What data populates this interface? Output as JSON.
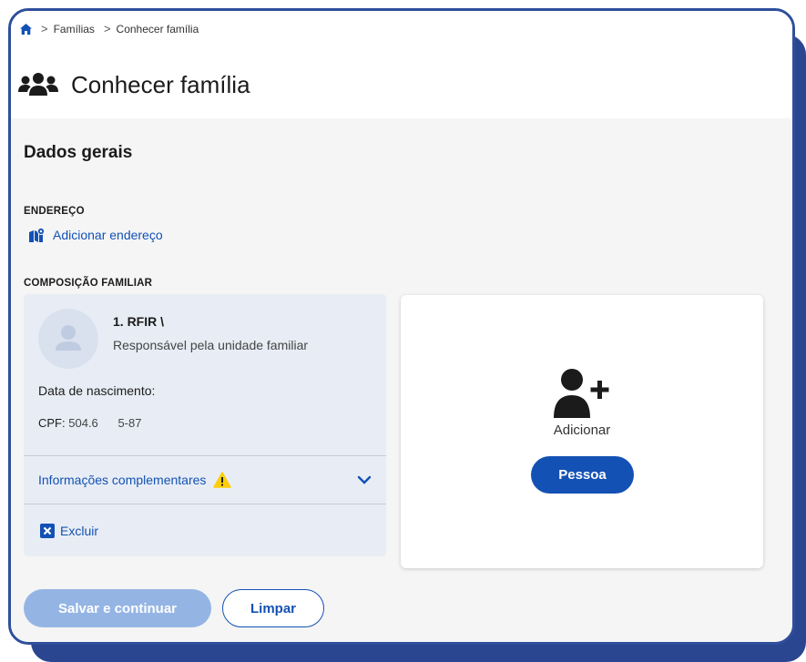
{
  "breadcrumb": {
    "items": [
      "Famílias",
      "Conhecer família"
    ]
  },
  "page": {
    "title": "Conhecer família"
  },
  "section": {
    "title": "Dados gerais",
    "address_label": "ENDEREÇO",
    "add_address": "Adicionar endereço",
    "composition_label": "COMPOSIÇÃO FAMILIAR"
  },
  "member": {
    "name": "1. RFIR \\",
    "role": "Responsável pela unidade familiar",
    "birth_label": "Data de nascimento:",
    "cpf_label": "CPF:",
    "cpf_value": "504.6      5-87",
    "info_label": "Informações complementares",
    "delete_label": "Excluir"
  },
  "add_card": {
    "label": "Adicionar",
    "button": "Pessoa"
  },
  "actions": {
    "save": "Salvar e continuar",
    "clear": "Limpar"
  },
  "colors": {
    "primary": "#1351b4",
    "primary_disabled": "#94b5e4",
    "warning": "#ffcd07",
    "frame": "#2f4f9c"
  }
}
